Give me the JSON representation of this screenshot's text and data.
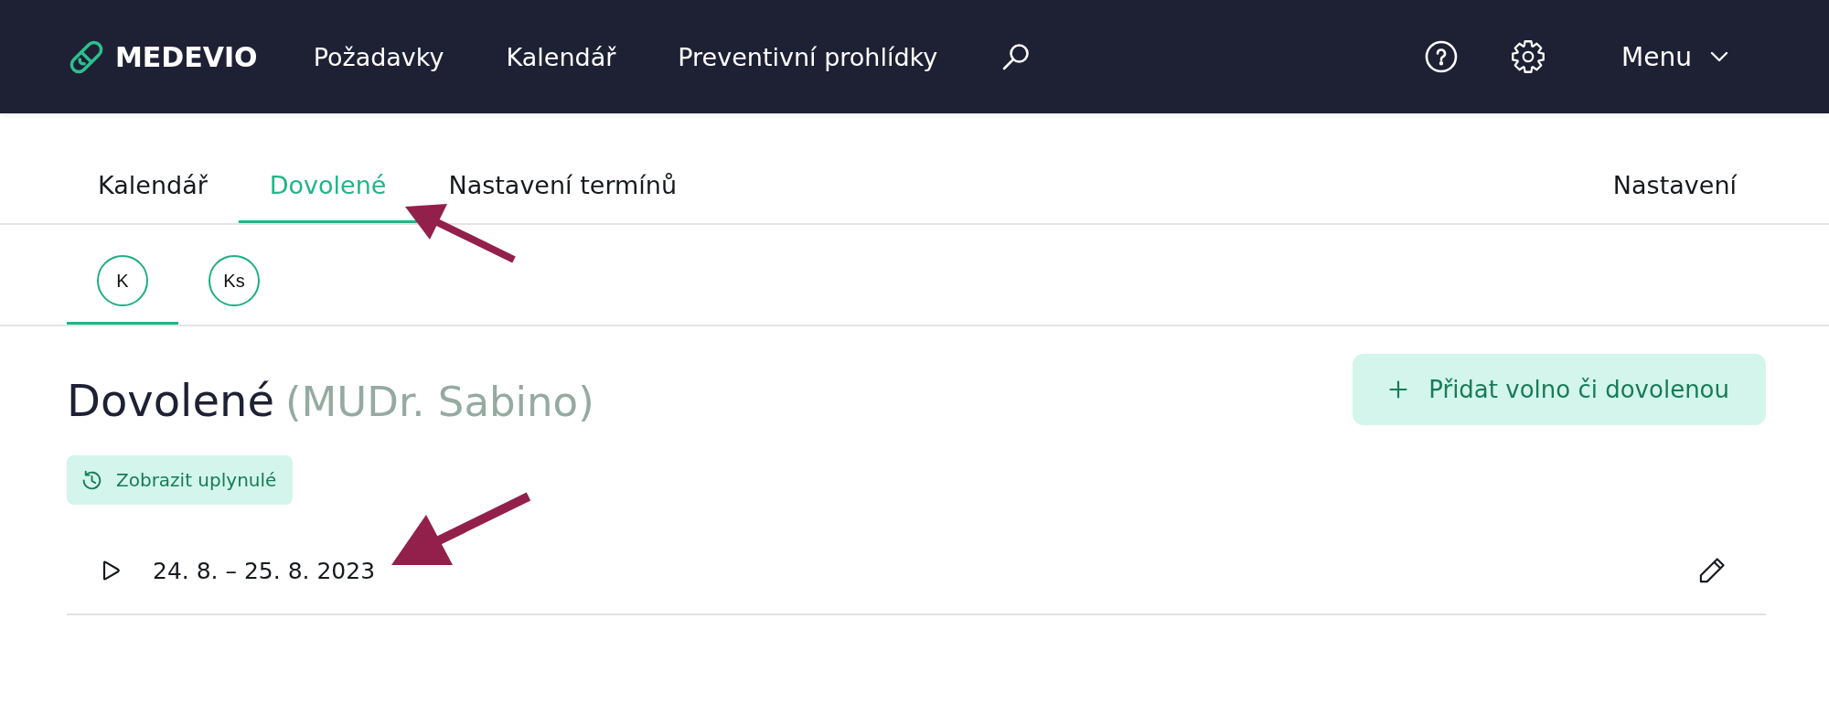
{
  "header": {
    "logo": "MEDEVIO",
    "nav": [
      {
        "label": "Požadavky"
      },
      {
        "label": "Kalendář"
      },
      {
        "label": "Preventivní prohlídky"
      }
    ],
    "menu": "Menu"
  },
  "tabs_bar": {
    "tabs": [
      {
        "label": "Kalendář",
        "selected": false
      },
      {
        "label": "Dovolené",
        "selected": true
      },
      {
        "label": "Nastavení termínů",
        "selected": false
      }
    ],
    "settings_link": "Nastavení"
  },
  "doctors": [
    {
      "initials": "K",
      "selected": true
    },
    {
      "initials": "Ks",
      "selected": false
    }
  ],
  "page": {
    "title": "Dovolené",
    "doctor": "(MUDr. Sabino)",
    "add_button": "Přidat volno či dovolenou",
    "show_past_button": "Zobrazit uplynulé"
  },
  "vacations": [
    {
      "dates": "24. 8. – 25. 8. 2023"
    }
  ]
}
